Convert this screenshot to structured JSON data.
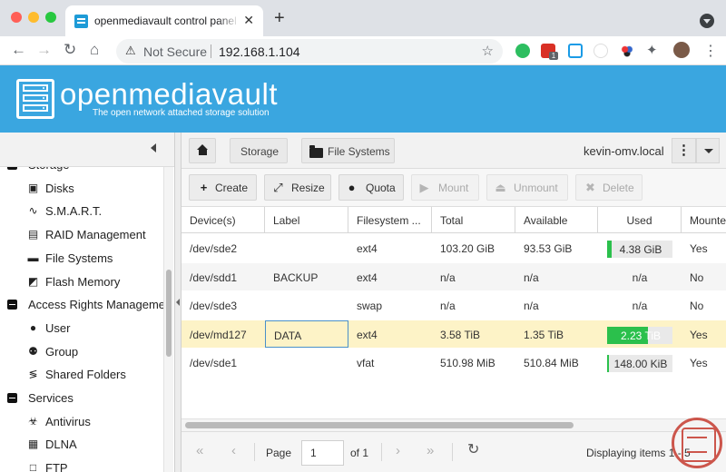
{
  "browser": {
    "tab_title": "openmediavault control panel - ",
    "tab_close": "✕",
    "new_tab": "+",
    "security_label": "Not Secure",
    "url": "192.168.1.104",
    "ext_badge_count": "1"
  },
  "app": {
    "brand": "openmediavault",
    "tagline": "The open network attached storage solution"
  },
  "sidebar": {
    "items": [
      {
        "type": "category",
        "label": "Storage",
        "icon": "minus-square-icon"
      },
      {
        "type": "item",
        "label": "Disks",
        "icon": "hdd-icon"
      },
      {
        "type": "item",
        "label": "S.M.A.R.T.",
        "icon": "pulse-icon"
      },
      {
        "type": "item",
        "label": "RAID Management",
        "icon": "raid-icon"
      },
      {
        "type": "item",
        "label": "File Systems",
        "icon": "folder-icon"
      },
      {
        "type": "item",
        "label": "Flash Memory",
        "icon": "flash-icon"
      },
      {
        "type": "category",
        "label": "Access Rights Managemen",
        "icon": "minus-square-icon"
      },
      {
        "type": "item",
        "label": "User",
        "icon": "user-icon"
      },
      {
        "type": "item",
        "label": "Group",
        "icon": "group-icon"
      },
      {
        "type": "item",
        "label": "Shared Folders",
        "icon": "share-icon"
      },
      {
        "type": "category",
        "label": "Services",
        "icon": "minus-square-icon"
      },
      {
        "type": "item",
        "label": "Antivirus",
        "icon": "biohazard-icon"
      },
      {
        "type": "item",
        "label": "DLNA",
        "icon": "film-icon"
      },
      {
        "type": "item",
        "label": "FTP",
        "icon": "ftp-icon"
      }
    ]
  },
  "breadcrumb": {
    "items": [
      "Storage",
      "File Systems"
    ],
    "hostname": "kevin-omv.local",
    "menu_glyph": "⋮"
  },
  "toolbar": {
    "buttons": [
      {
        "label": "Create",
        "icon": "plus-icon",
        "enabled": true
      },
      {
        "label": "Resize",
        "icon": "expand-icon",
        "enabled": true
      },
      {
        "label": "Quota",
        "icon": "users-icon",
        "enabled": true
      },
      {
        "label": "Mount",
        "icon": "play-icon",
        "enabled": false
      },
      {
        "label": "Unmount",
        "icon": "eject-icon",
        "enabled": false
      },
      {
        "label": "Delete",
        "icon": "times-icon",
        "enabled": false
      }
    ]
  },
  "grid": {
    "columns": [
      "Device(s)",
      "Label",
      "Filesystem ...",
      "Total",
      "Available",
      "Used",
      "Mounted"
    ],
    "rows": [
      {
        "device": "/dev/sde2",
        "label": "",
        "fs": "ext4",
        "total": "103.20 GiB",
        "available": "93.53 GiB",
        "used": "4.38 GiB",
        "used_fraction": 0.04,
        "mounted": "Yes"
      },
      {
        "device": "/dev/sdd1",
        "label": "BACKUP",
        "fs": "ext4",
        "total": "n/a",
        "available": "n/a",
        "used": "n/a",
        "used_fraction": null,
        "mounted": "No"
      },
      {
        "device": "/dev/sde3",
        "label": "",
        "fs": "swap",
        "total": "n/a",
        "available": "n/a",
        "used": "n/a",
        "used_fraction": null,
        "mounted": "No"
      },
      {
        "device": "/dev/md127",
        "label": "DATA",
        "fs": "ext4",
        "total": "3.58 TiB",
        "available": "1.35 TiB",
        "used": "2.23 TiB",
        "used_fraction": 0.62,
        "mounted": "Yes"
      },
      {
        "device": "/dev/sde1",
        "label": "",
        "fs": "vfat",
        "total": "510.98 MiB",
        "available": "510.84 MiB",
        "used": "148.00 KiB",
        "used_fraction": 0.0003,
        "mounted": "Yes"
      }
    ]
  },
  "pager": {
    "page_label": "Page",
    "page_value": "1",
    "of_label": "of 1",
    "displaying": "Displaying items 1 - 5"
  },
  "colors": {
    "brand_blue": "#3aa6e0",
    "usage_green": "#2bc04c",
    "selected_row": "#fdf3c7"
  }
}
